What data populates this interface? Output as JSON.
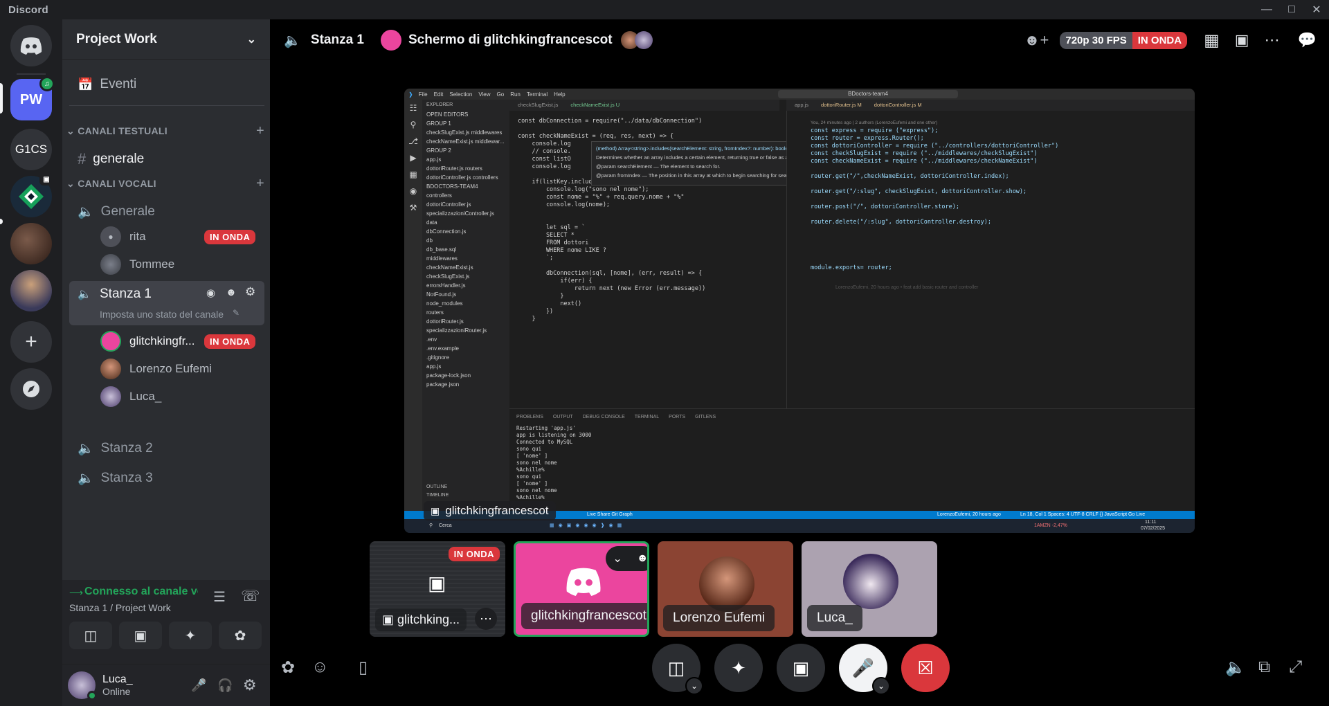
{
  "app": {
    "title": "Discord"
  },
  "guilds": [
    "PW",
    "G1CS"
  ],
  "server": {
    "name": "Project Work"
  },
  "sidebar": {
    "events": "Eventi",
    "text_category": "CANALI TESTUALI",
    "text_channel": "generale",
    "voice_category": "CANALI VOCALI",
    "voice_channels": [
      {
        "name": "Generale",
        "users": [
          {
            "name": "rita",
            "live": "IN ONDA"
          },
          {
            "name": "Tommee"
          }
        ]
      },
      {
        "name": "Stanza 1",
        "status": "Imposta uno stato del canale",
        "users": [
          {
            "name": "glitchkingfr...",
            "live": "IN ONDA"
          },
          {
            "name": "Lorenzo Eufemi"
          },
          {
            "name": "Luca_"
          }
        ]
      },
      {
        "name": "Stanza 2"
      },
      {
        "name": "Stanza 3"
      }
    ]
  },
  "connection": {
    "status": "Connesso al canale vo",
    "location": "Stanza 1 / Project Work"
  },
  "user": {
    "name": "Luca_",
    "status": "Online"
  },
  "topbar": {
    "channel": "Stanza 1",
    "stream": "Schermo di glitchkingfrancescot",
    "quality": "720p 30 FPS",
    "live": "IN ONDA"
  },
  "screen": {
    "menu": [
      "File",
      "Edit",
      "Selection",
      "View",
      "Go",
      "Run",
      "Terminal",
      "Help"
    ],
    "search": "BDoctors-team4",
    "explorer": "EXPLORER",
    "tabs_left": [
      "checkSlugExist.js",
      "checkNameExist.js U"
    ],
    "tabs_right": [
      "app.js",
      "dottoriRouter.js M",
      "dottoriController.js M"
    ],
    "tree": [
      "OPEN EDITORS",
      "GROUP 1",
      "checkSlugExist.js middlewares",
      "checkNameExist.js middlewar... U",
      "GROUP 2",
      "app.js",
      "dottoriRouter.js routers",
      "dottoriController.js controllers",
      "BDOCTORS-TEAM4",
      "controllers",
      "dottoriController.js",
      "specializzazioniController.js",
      "data",
      "dbConnection.js",
      "db",
      "db_base.sql",
      "middlewares",
      "checkNameExist.js",
      "checkSlugExist.js",
      "errorsHandler.js",
      "NotFound.js",
      "node_modules",
      "routers",
      "dottoriRouter.js",
      "specializzazioniRouter.js",
      ".env",
      ".env.example",
      ".gitignore",
      "app.js",
      "package-lock.json",
      "package.json"
    ],
    "code_left": "const dbConnection = require(\"../data/dbConnection\")\n\nconst checkNameExist = (req, res, next) => {\n    console.log\n    // console.\n    const listO\n    console.log\n\n    if(listKey.includes(\"nome\")){\n        console.log(\"sono nel nome\");\n        const nome = \"%\" + req.query.nome + \"%\"\n        console.log(nome);\n\n\n        let sql = `\n        SELECT *\n        FROM dottori\n        WHERE nome LIKE ?\n        `;\n\n        dbConnection(sql, [nome], (err, result) => {\n            if(err) {\n                return next (new Error (err.message))\n            }\n            next()\n        })\n    }\n\n\n\n\n}\n\nmodule.exports = checkNameExist;",
    "hover": [
      "(method) Array<string>.includes(searchElement: string, fromIndex?: number): boolean",
      "Determines whether an array includes a certain element, returning true or false as appropriate.",
      "@param searchElement — The element to search for.",
      "@param fromIndex — The position in this array at which to begin searching for searchElement."
    ],
    "code_right": "const express = require (\"express\");\nconst router = express.Router();\nconst dottoriController = require (\"../controllers/dottoriController\")\nconst checkSlugExist = require (\"../middlewares/checkSlugExist\")\nconst checkNameExist = require (\"../middlewares/checkNameExist\")\n\nrouter.get(\"/\",checkNameExist, dottoriController.index);\n\nrouter.get(\"/:slug\", checkSlugExist, dottoriController.show);\n\nrouter.post(\"/\", dottoriController.store);\n\nrouter.delete(\"/:slug\", dottoriController.destroy);\n\n\n\n\n\nmodule.exports= router;",
    "blame": "You, 24 minutes ago | 2 authors (LorenzoEufemi and one other)",
    "blame2": "LorenzoEufemi, 20 hours ago • feat add basic router and controller",
    "panel_tabs": [
      "PROBLEMS",
      "OUTPUT",
      "DEBUG CONSOLE",
      "TERMINAL",
      "PORTS",
      "GITLENS"
    ],
    "terminal": "Restarting 'app.js'\napp is listening on 3000\nConnected to MySQL\nsono qui\n[ 'nome' ]\nsono nel nome\n%Achille%\nsono qui\n[ 'nome' ]\nsono nel nome\n%Achille%",
    "statusbar": "Ln 18, Col 1   Spaces: 4   UTF-8   CRLF   {} JavaScript   Go Live",
    "status_left": "Live Share    Git Graph",
    "status_author": "LorenzoEufemi, 20 hours ago",
    "taskbar_search": "Cerca",
    "taskbar_stock": "1AMZN  -2,47%",
    "clock": "11:11",
    "date": "07/02/2025",
    "outline": "OUTLINE",
    "timeline": "TIMELINE",
    "streamer_tag": "glitchkingfrancescot"
  },
  "tiles": [
    {
      "name": "glitchking...",
      "live": "IN ONDA"
    },
    {
      "name": "glitchkingfrancescot"
    },
    {
      "name": "Lorenzo Eufemi"
    },
    {
      "name": "Luca_"
    }
  ],
  "colors": {
    "accent": "#5865f2",
    "live": "#da373c",
    "online": "#23a55a",
    "speaking_tile": "#eb459e"
  }
}
